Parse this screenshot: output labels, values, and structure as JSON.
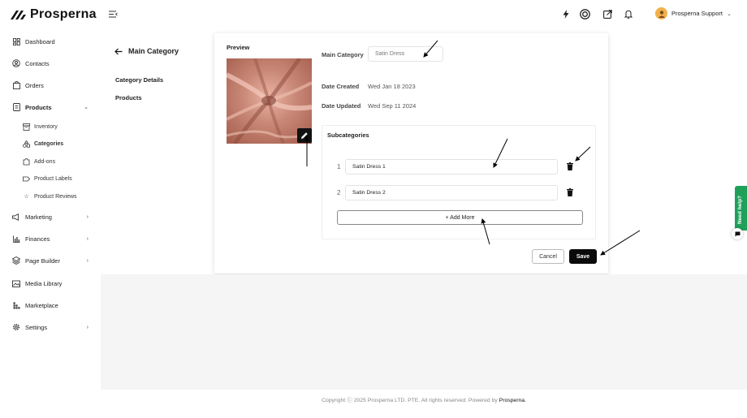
{
  "brand": {
    "name": "Prosperna"
  },
  "sidebar": {
    "items": [
      {
        "label": "Dashboard",
        "icon": "dashboard-icon"
      },
      {
        "label": "Contacts",
        "icon": "contacts-icon"
      },
      {
        "label": "Orders",
        "icon": "orders-icon"
      },
      {
        "label": "Products",
        "icon": "products-icon"
      },
      {
        "label": "Marketing",
        "icon": "marketing-icon"
      },
      {
        "label": "Finances",
        "icon": "finances-icon"
      },
      {
        "label": "Page Builder",
        "icon": "page-builder-icon"
      },
      {
        "label": "Media Library",
        "icon": "media-library-icon"
      },
      {
        "label": "Marketplace",
        "icon": "marketplace-icon"
      },
      {
        "label": "Settings",
        "icon": "settings-icon"
      }
    ],
    "products_sub": [
      {
        "label": "Inventory",
        "icon": "inventory-icon"
      },
      {
        "label": "Categories",
        "icon": "categories-icon"
      },
      {
        "label": "Add-ons",
        "icon": "add-ons-icon"
      },
      {
        "label": "Product Labels",
        "icon": "label-icon"
      },
      {
        "label": "Product Reviews",
        "icon": "star-icon"
      }
    ]
  },
  "header": {
    "user_name": "Prosperna Support"
  },
  "left_panel": {
    "title": "Main Category",
    "links": [
      "Category Details",
      "Products"
    ]
  },
  "card": {
    "preview_label": "Preview",
    "main_category_label": "Main Category",
    "main_category_value": "Satin Dress",
    "date_created_label": "Date Created",
    "date_created_value": "Wed Jan 18 2023",
    "date_updated_label": "Date Updated",
    "date_updated_value": "Wed Sep 11 2024",
    "subcategories_title": "Subcategories",
    "subcategories": [
      {
        "num": "1",
        "value": "Satin Dress 1"
      },
      {
        "num": "2",
        "value": "Satin Dress 2"
      }
    ],
    "add_more_label": "+ Add More",
    "cancel_label": "Cancel",
    "save_label": "Save"
  },
  "footer": {
    "text": "Copyright ⓒ 2025 Prosperna LTD. PTE. All rights reserved. Powered by",
    "brand": "Prosperna."
  },
  "help": {
    "label": "Need help?"
  },
  "colors": {
    "accent": "#0a0a0a",
    "help_green": "#1ea05a",
    "avatar": "#f1b04b"
  }
}
